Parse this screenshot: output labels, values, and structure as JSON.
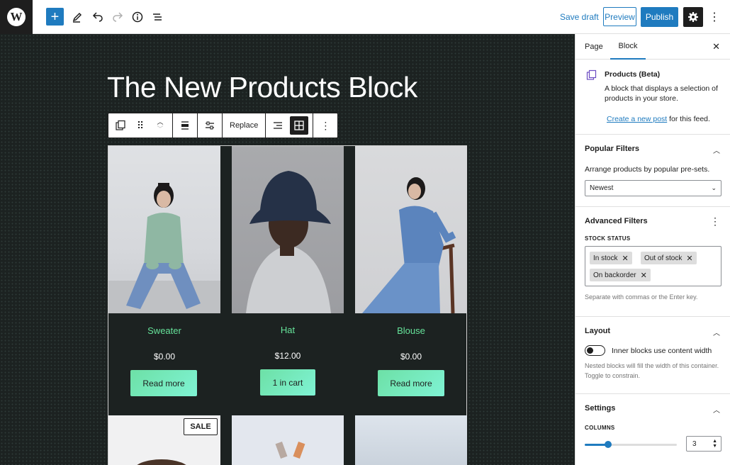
{
  "topbar": {
    "logo": "W",
    "add_icon": "+",
    "tools": [
      "pencil-icon",
      "undo-icon",
      "redo-icon",
      "info-icon",
      "list-view-icon"
    ],
    "save_draft": "Save draft",
    "preview": "Preview",
    "publish": "Publish"
  },
  "editor": {
    "title": "The New Products Block",
    "toolbar": {
      "replace": "Replace"
    },
    "products": [
      {
        "name": "Sweater",
        "price": "$0.00",
        "button": "Read more"
      },
      {
        "name": "Hat",
        "price": "$12.00",
        "button": "1 in cart"
      },
      {
        "name": "Blouse",
        "price": "$0.00",
        "button": "Read more"
      }
    ],
    "sale_badge": "SALE"
  },
  "sidebar": {
    "tabs": [
      "Page",
      "Block"
    ],
    "active_tab": "Block",
    "block_card": {
      "title": "Products (Beta)",
      "description": "A block that displays a selection of products in your store.",
      "link_text": "Create a new post",
      "link_suffix": " for this feed."
    },
    "popular_filters": {
      "title": "Popular Filters",
      "description": "Arrange products by popular pre-sets.",
      "selected": "Newest"
    },
    "advanced_filters": {
      "title": "Advanced Filters",
      "stock_label": "STOCK STATUS",
      "tokens": [
        "In stock",
        "Out of stock",
        "On backorder"
      ],
      "help": "Separate with commas or the Enter key."
    },
    "layout": {
      "title": "Layout",
      "toggle_label": "Inner blocks use content width",
      "toggle_on": false,
      "help": "Nested blocks will fill the width of this container. Toggle to constrain."
    },
    "settings": {
      "title": "Settings",
      "columns_label": "COLUMNS",
      "columns_value": "3"
    }
  },
  "colors": {
    "accent": "#1f7bbf",
    "canvas": "#1c2221",
    "product_name": "#66e39a"
  }
}
